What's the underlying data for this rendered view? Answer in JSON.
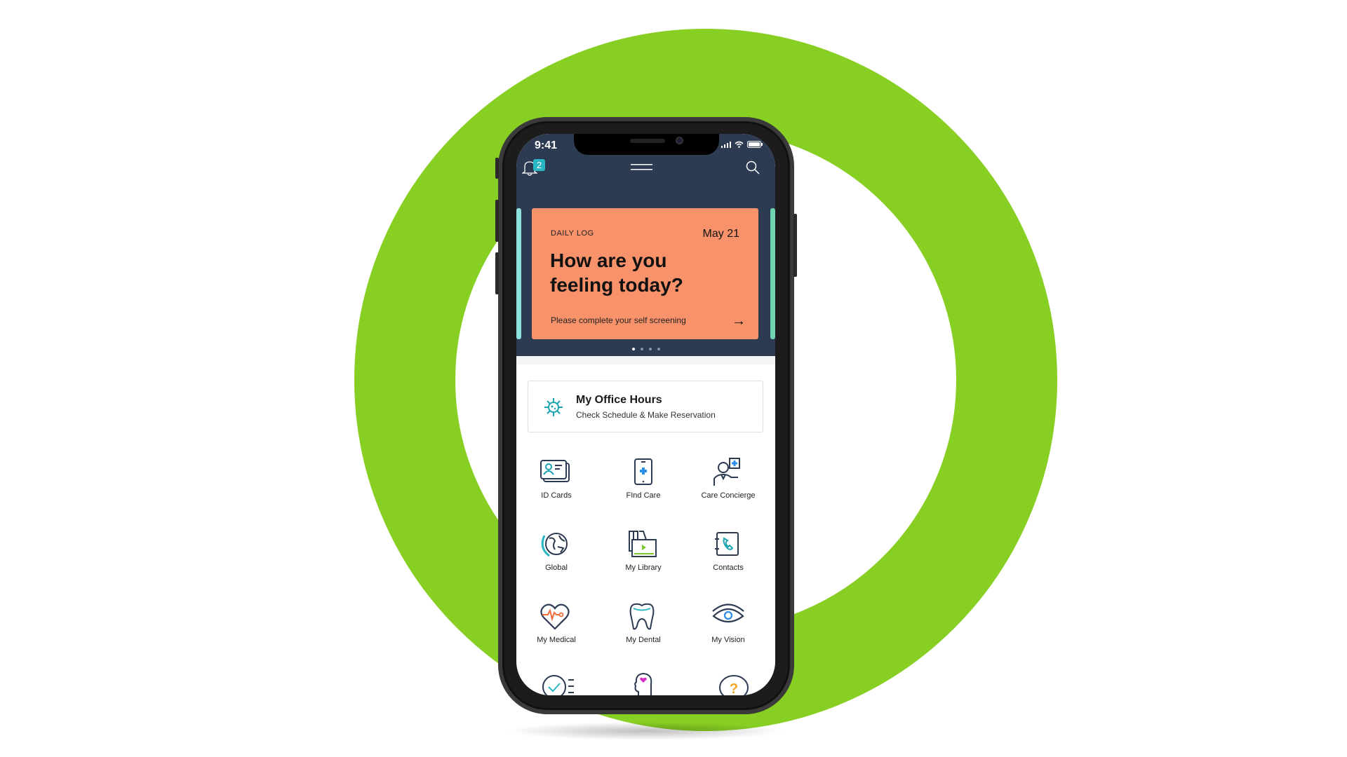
{
  "status_bar": {
    "time": "9:41"
  },
  "header": {
    "notification_count": "2",
    "icons": [
      "bell-icon",
      "hamburger-menu-icon",
      "search-icon"
    ]
  },
  "card": {
    "label": "DAILY LOG",
    "date": "May 21",
    "question": "How are you feeling today?",
    "subtitle": "Please complete your self screening",
    "pages": 4,
    "active_page": 1
  },
  "office": {
    "title": "My Office Hours",
    "subtitle": "Check Schedule & Make Reservation"
  },
  "grid": [
    {
      "label": "ID Cards",
      "icon": "id-card-icon"
    },
    {
      "label": "FInd Care",
      "icon": "phone-medical-icon"
    },
    {
      "label": "Care Concierge",
      "icon": "concierge-icon"
    },
    {
      "label": "Global",
      "icon": "globe-icon"
    },
    {
      "label": "My Library",
      "icon": "library-icon"
    },
    {
      "label": "Contacts",
      "icon": "contacts-icon"
    },
    {
      "label": "My Medical",
      "icon": "heart-pulse-icon"
    },
    {
      "label": "My Dental",
      "icon": "tooth-icon"
    },
    {
      "label": "My Vision",
      "icon": "eye-icon"
    }
  ],
  "colors": {
    "accent_green": "#88cf23",
    "header_navy": "#2c3a52",
    "card_orange": "#f7926a",
    "teal": "#2ab7c4"
  }
}
